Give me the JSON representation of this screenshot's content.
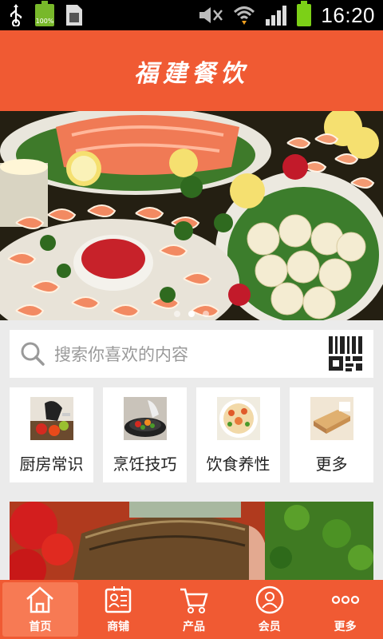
{
  "status_bar": {
    "time": "16:20",
    "battery_percent_label": "100%",
    "icons": [
      "usb-icon",
      "battery-icon",
      "sim-icon",
      "mute-icon",
      "wifi-icon",
      "signal-icon",
      "battery-icon"
    ]
  },
  "header": {
    "title": "福建餐饮"
  },
  "banner": {
    "slides": 3,
    "active_slide": 2
  },
  "search": {
    "placeholder": "搜索你喜欢的内容"
  },
  "categories": [
    {
      "label": "厨房常识",
      "icon": "kitchen-photo"
    },
    {
      "label": "烹饪技巧",
      "icon": "cooking-photo"
    },
    {
      "label": "饮食养性",
      "icon": "dish-photo"
    },
    {
      "label": "更多",
      "icon": "bread-photo"
    }
  ],
  "tabs": [
    {
      "label": "首页",
      "icon": "home-icon",
      "active": true
    },
    {
      "label": "商铺",
      "icon": "shop-icon",
      "active": false
    },
    {
      "label": "产品",
      "icon": "cart-icon",
      "active": false
    },
    {
      "label": "会员",
      "icon": "member-icon",
      "active": false
    },
    {
      "label": "更多",
      "icon": "more-icon",
      "active": false
    }
  ],
  "colors": {
    "accent": "#f05a33",
    "tab_active": "#f77a54",
    "background": "#ebebeb"
  }
}
